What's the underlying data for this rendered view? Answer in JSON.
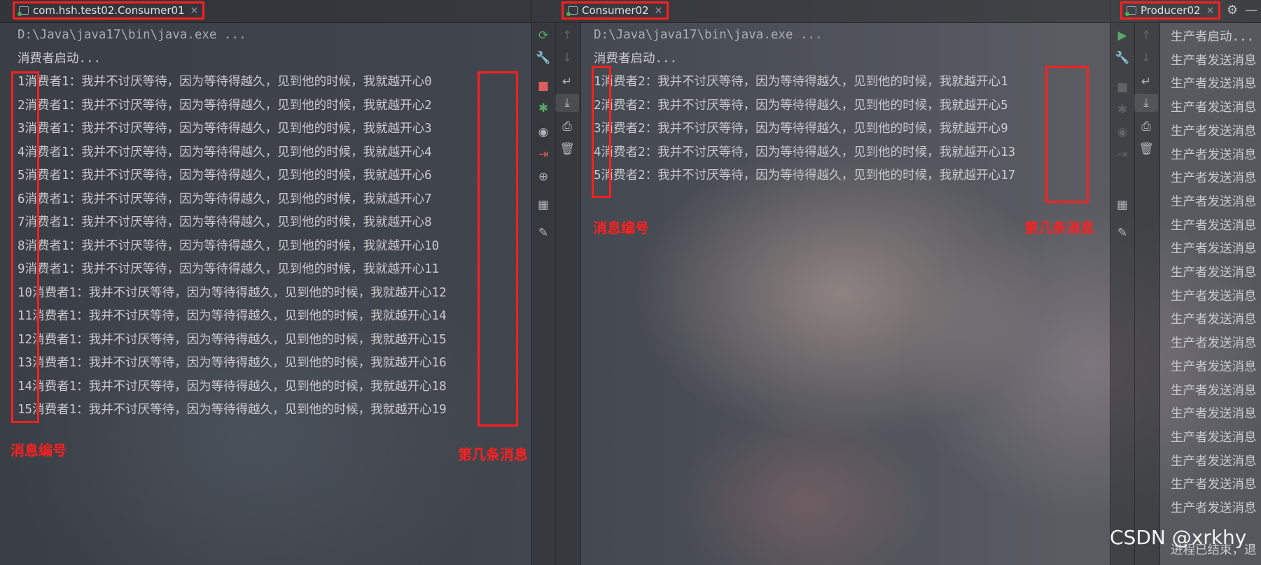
{
  "colors": {
    "annotation_red": "#ff1f1f",
    "background": "#2b2d30"
  },
  "panes": {
    "consumer01": {
      "tab_label": "com.hsh.test02.Consumer01",
      "lines": [
        "D:\\Java\\java17\\bin\\java.exe ...",
        "消费者启动...",
        "1消费者1：我并不讨厌等待，因为等待得越久，见到他的时候，我就越开心0",
        "2消费者1：我并不讨厌等待，因为等待得越久，见到他的时候，我就越开心2",
        "3消费者1：我并不讨厌等待，因为等待得越久，见到他的时候，我就越开心3",
        "4消费者1：我并不讨厌等待，因为等待得越久，见到他的时候，我就越开心4",
        "5消费者1：我并不讨厌等待，因为等待得越久，见到他的时候，我就越开心6",
        "6消费者1：我并不讨厌等待，因为等待得越久，见到他的时候，我就越开心7",
        "7消费者1：我并不讨厌等待，因为等待得越久，见到他的时候，我就越开心8",
        "8消费者1：我并不讨厌等待，因为等待得越久，见到他的时候，我就越开心10",
        "9消费者1：我并不讨厌等待，因为等待得越久，见到他的时候，我就越开心11",
        "10消费者1：我并不讨厌等待，因为等待得越久，见到他的时候，我就越开心12",
        "11消费者1：我并不讨厌等待，因为等待得越久，见到他的时候，我就越开心14",
        "12消费者1：我并不讨厌等待，因为等待得越久，见到他的时候，我就越开心15",
        "13消费者1：我并不讨厌等待，因为等待得越久，见到他的时候，我就越开心16",
        "14消费者1：我并不讨厌等待，因为等待得越久，见到他的时候，我就越开心18",
        "15消费者1：我并不讨厌等待，因为等待得越久，见到他的时候，我就越开心19"
      ],
      "annotation_left": "消息编号",
      "annotation_right": "第几条消息"
    },
    "consumer02": {
      "tab_label": "Consumer02",
      "lines": [
        "D:\\Java\\java17\\bin\\java.exe ...",
        "消费者启动...",
        "1消费者2：我并不讨厌等待，因为等待得越久，见到他的时候，我就越开心1",
        "2消费者2：我并不讨厌等待，因为等待得越久，见到他的时候，我就越开心5",
        "3消费者2：我并不讨厌等待，因为等待得越久，见到他的时候，我就越开心9",
        "4消费者2：我并不讨厌等待，因为等待得越久，见到他的时候，我就越开心13",
        "5消费者2：我并不讨厌等待，因为等待得越久，见到他的时候，我就越开心17"
      ],
      "annotation_left": "消息编号",
      "annotation_right": "第几条消息"
    },
    "producer02": {
      "tab_label": "Producer02",
      "lines": [
        "生产者启动...",
        "生产者发送消息",
        "生产者发送消息",
        "生产者发送消息",
        "生产者发送消息",
        "生产者发送消息",
        "生产者发送消息",
        "生产者发送消息",
        "生产者发送消息",
        "生产者发送消息",
        "生产者发送消息",
        "生产者发送消息",
        "生产者发送消息",
        "生产者发送消息",
        "生产者发送消息",
        "生产者发送消息",
        "生产者发送消息",
        "生产者发送消息",
        "生产者发送消息",
        "生产者发送消息",
        "生产者发送消息"
      ],
      "footer": "进程已结束，退"
    }
  },
  "toolbar_icons": [
    "rerun-icon",
    "wrench-icon",
    "stop-icon",
    "debug-icon",
    "camera-icon",
    "exit-icon",
    "zoom-icon",
    "layout-icon",
    "pin-icon",
    "up-arrow-icon",
    "down-arrow-icon",
    "soft-wrap-icon",
    "scroll-end-icon",
    "print-icon",
    "trash-icon"
  ],
  "watermark": "CSDN @xrkhy"
}
